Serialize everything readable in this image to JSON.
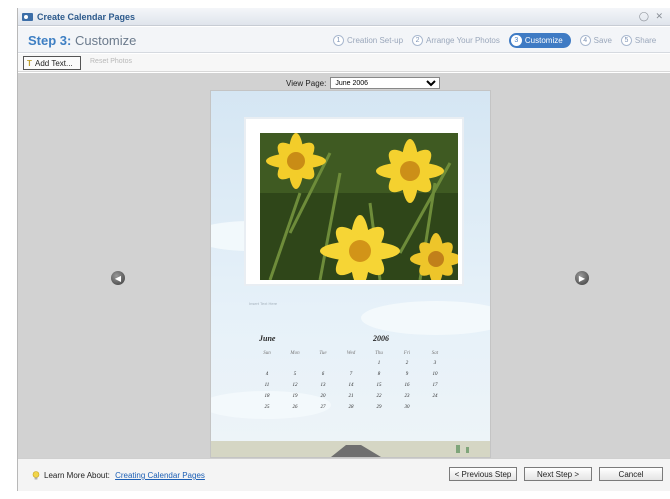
{
  "window": {
    "title": "Create Calendar Pages",
    "controls": "◯ ✕"
  },
  "step": {
    "prefix": "Step 3:",
    "name": "Customize"
  },
  "steps": [
    {
      "num": "1",
      "label": "Creation Set-up"
    },
    {
      "num": "2",
      "label": "Arrange Your Photos"
    },
    {
      "num": "3",
      "label": "Customize"
    },
    {
      "num": "4",
      "label": "Save"
    },
    {
      "num": "5",
      "label": "Share"
    }
  ],
  "toolbar": {
    "add_text": "Add Text...",
    "reset_photos": "Reset Photos"
  },
  "view": {
    "label": "View Page:",
    "value": "June 2006"
  },
  "calendar": {
    "caption": "Insert Text Here",
    "month": "June",
    "year": "2006",
    "weekdays": [
      "Sun",
      "Mon",
      "Tue",
      "Wed",
      "Thu",
      "Fri",
      "Sat"
    ],
    "weeks": [
      [
        "",
        "",
        "",
        "",
        "1",
        "2",
        "3"
      ],
      [
        "4",
        "5",
        "6",
        "7",
        "8",
        "9",
        "10"
      ],
      [
        "11",
        "12",
        "13",
        "14",
        "15",
        "16",
        "17"
      ],
      [
        "18",
        "19",
        "20",
        "21",
        "22",
        "23",
        "24"
      ],
      [
        "25",
        "26",
        "27",
        "28",
        "29",
        "30",
        ""
      ]
    ]
  },
  "footer": {
    "learn_label": "Learn More About:",
    "learn_link": "Creating Calendar Pages",
    "previous": "< Previous Step",
    "next": "Next Step >",
    "cancel": "Cancel"
  }
}
